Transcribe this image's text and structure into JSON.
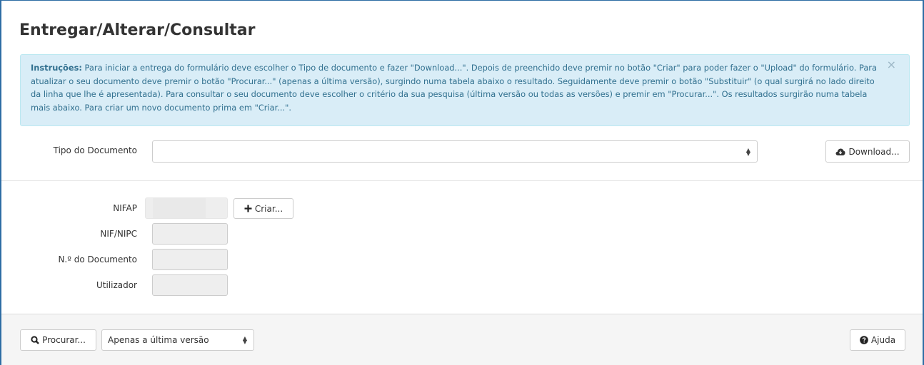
{
  "page": {
    "title": "Entregar/Alterar/Consultar"
  },
  "alert": {
    "label": "Instruções:",
    "text": " Para iniciar a entrega do formulário deve escolher o Tipo de documento e fazer \"Download...\". Depois de preenchido deve premir no botão \"Criar\" para poder fazer o \"Upload\" do formulário. Para atualizar o seu documento deve premir o botão \"Procurar...\" (apenas a última versão), surgindo numa tabela abaixo o resultado. Seguidamente deve premir o botão \"Substituir\" (o qual surgirá no lado direito da linha que lhe é apresentada). Para consultar o seu documento deve escolher o critério da sua pesquisa (última versão ou todas as versões) e premir em \"Procurar...\". Os resultados surgirão numa tabela mais abaixo. Para criar um novo documento prima em \"Criar...\".",
    "close": "×"
  },
  "form": {
    "tipo_label": "Tipo do Documento",
    "tipo_value": "",
    "download_label": "Download...",
    "nifap_label": "NIFAP",
    "nifap_value": "",
    "criar_label": "Criar...",
    "nif_label": "NIF/NIPC",
    "ndoc_label": "N.º do Documento",
    "utilizador_label": "Utilizador"
  },
  "footer": {
    "procurar_label": "Procurar...",
    "version_selected": "Apenas a última versão",
    "ajuda_label": "Ajuda"
  },
  "icons": {
    "download": "cloud-download-icon",
    "criar": "plus-icon",
    "procurar": "search-icon",
    "ajuda": "question-circle-icon",
    "select": "sort-caret-icon"
  },
  "colors": {
    "alert_bg": "#d9edf7",
    "alert_text": "#31708f",
    "frame_border": "#2e6da4"
  }
}
